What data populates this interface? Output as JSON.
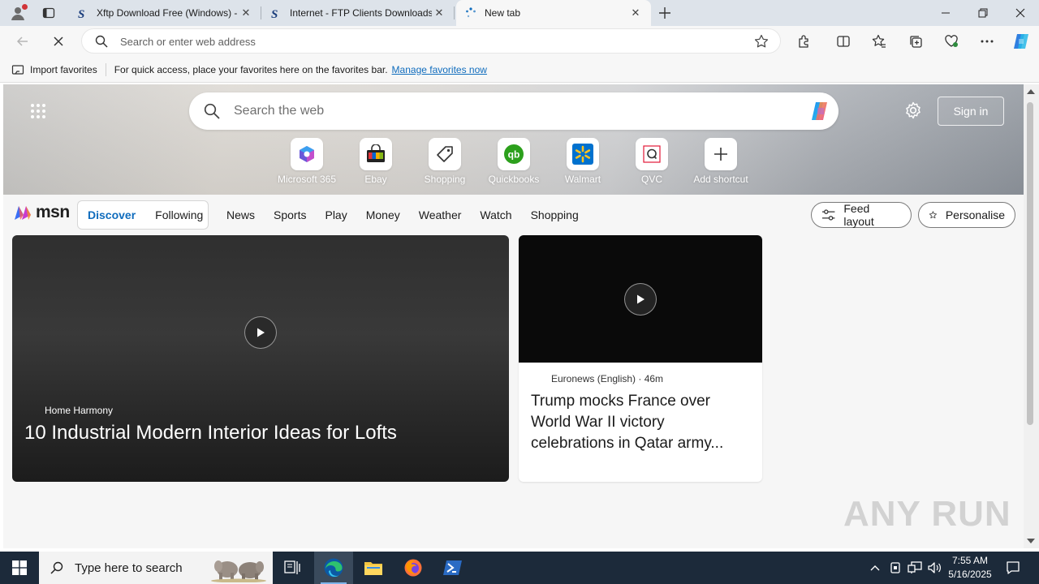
{
  "browser": {
    "tabs": [
      {
        "title": "Xftp Download Free (Windows) -",
        "active": false
      },
      {
        "title": "Internet - FTP Clients Downloads",
        "active": false
      },
      {
        "title": "New tab",
        "active": true
      }
    ],
    "address_placeholder": "Search or enter web address",
    "favbar": {
      "import_label": "Import favorites",
      "message": "For quick access, place your favorites here on the favorites bar.",
      "manage_link": "Manage favorites now"
    }
  },
  "newtab": {
    "search_placeholder": "Search the web",
    "signin_label": "Sign in",
    "shortcuts": [
      {
        "label": "Microsoft 365",
        "icon": "m365-icon"
      },
      {
        "label": "Ebay",
        "icon": "ebay-icon"
      },
      {
        "label": "Shopping",
        "icon": "tag-icon"
      },
      {
        "label": "Quickbooks",
        "icon": "quickbooks-icon"
      },
      {
        "label": "Walmart",
        "icon": "walmart-icon"
      },
      {
        "label": "QVC",
        "icon": "qvc-icon"
      },
      {
        "label": "Add shortcut",
        "icon": "plus-icon"
      }
    ],
    "msn": {
      "logo": "msn",
      "discover": "Discover",
      "following": "Following",
      "links": [
        "News",
        "Sports",
        "Play",
        "Money",
        "Weather",
        "Watch",
        "Shopping"
      ],
      "feed_layout": "Feed layout",
      "personalise": "Personalise"
    },
    "cards": {
      "big": {
        "source": "Home Harmony",
        "headline": "10 Industrial Modern Interior Ideas for Lofts"
      },
      "small": {
        "meta": "Euronews (English) · 46m",
        "headline": "Trump mocks France over World War II victory celebrations in Qatar army..."
      }
    },
    "watermark": "ANY RUN"
  },
  "taskbar": {
    "search_placeholder": "Type here to search",
    "time": "7:55 AM",
    "date": "5/16/2025"
  },
  "colors": {
    "accent": "#0f6cbd",
    "taskbar": "#1c2a3a"
  }
}
